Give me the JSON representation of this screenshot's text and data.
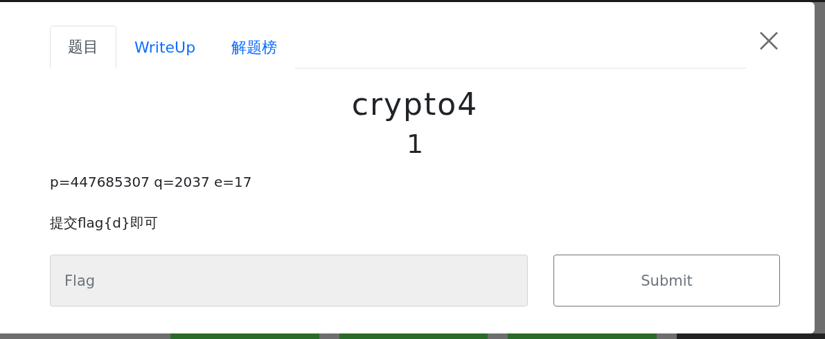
{
  "tabs": [
    {
      "label": "题目",
      "selected": true
    },
    {
      "label": "WriteUp",
      "selected": false
    },
    {
      "label": "解题榜",
      "selected": false
    }
  ],
  "challenge": {
    "title": "crypto4",
    "score": "1",
    "description": "p=447685307 q=2037 e=17",
    "hint": "提交flag{d}即可"
  },
  "flag_field": {
    "placeholder": "Flag"
  },
  "submit_button": "Submit"
}
